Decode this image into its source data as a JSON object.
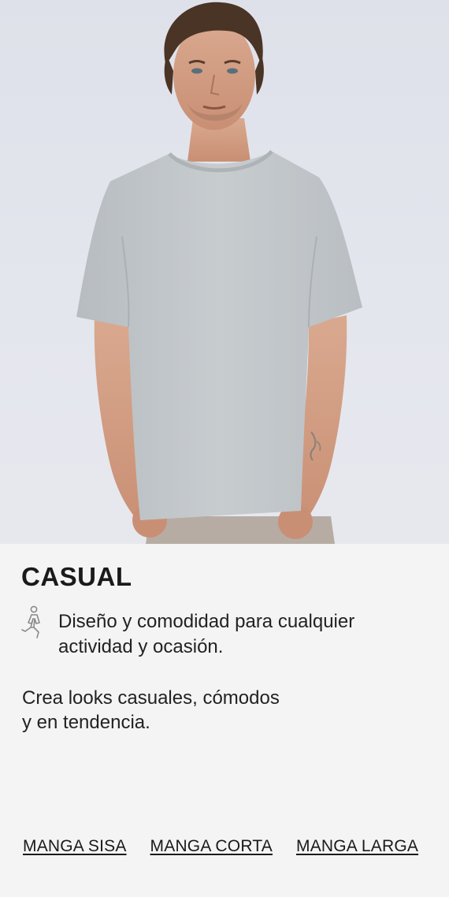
{
  "hero": {
    "image": "model-wearing-light-gray-oversized-t-shirt",
    "background_color": "#e2e4ec",
    "shirt_color": "#c5cacd"
  },
  "card": {
    "title": "CASUAL",
    "feature": {
      "icon": "walking-person-icon",
      "line1": "Diseño y comodidad para cualquier",
      "line2": "actividad y ocasión."
    },
    "description": {
      "line1": "Crea looks casuales, cómodos",
      "line2": "y en tendencia."
    },
    "links": [
      {
        "label": "MANGA SISA"
      },
      {
        "label": "MANGA CORTA"
      },
      {
        "label": "MANGA LARGA"
      }
    ]
  }
}
